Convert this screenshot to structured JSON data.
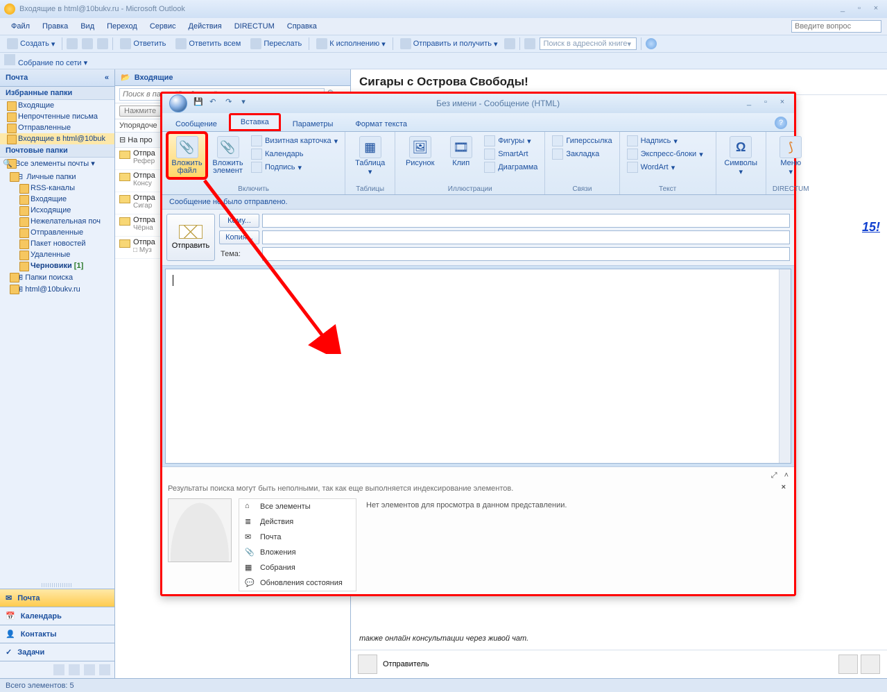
{
  "window_title": "Входящие в html@10bukv.ru - Microsoft Outlook",
  "menu": [
    "Файл",
    "Правка",
    "Вид",
    "Переход",
    "Сервис",
    "Действия",
    "DIRECTUM",
    "Справка"
  ],
  "question_placeholder": "Введите вопрос",
  "toolbar": {
    "create": "Создать",
    "reply": "Ответить",
    "reply_all": "Ответить всем",
    "forward": "Переслать",
    "follow_up": "К исполнению",
    "send_receive": "Отправить и получить",
    "addressbook_ph": "Поиск в адресной книге"
  },
  "toolbar2": {
    "meeting": "Собрание по сети"
  },
  "nav": {
    "header": "Почта",
    "fav_hdr": "Избранные папки",
    "fav": [
      "Входящие",
      "Непрочтенные письма",
      "Отправленные",
      "Входящие в html@10buk"
    ],
    "mail_hdr": "Почтовые папки",
    "all_items": "Все элементы почты",
    "tree_root": "Личные папки",
    "tree": [
      "RSS-каналы",
      "Входящие",
      "Исходящие",
      "Нежелательная поч",
      "Отправленные",
      "Пакет новостей",
      "Удаленные"
    ],
    "drafts": "Черновики",
    "drafts_count": "[1]",
    "search_folders": "Папки поиска",
    "account": "html@10bukv.ru",
    "big": [
      "Почта",
      "Календарь",
      "Контакты",
      "Задачи"
    ]
  },
  "list": {
    "header": "Входящие",
    "search_ph": "Поиск в папке \"Входящие\"",
    "hint_btn": "Нажмите",
    "sort": "Упорядоче",
    "group1": "На про",
    "msgs": [
      {
        "l1": "Отпра",
        "l2": "Рефер"
      },
      {
        "l1": "Отпра",
        "l2": "Консу"
      },
      {
        "l1": "Отпра",
        "l2": "Сигар"
      },
      {
        "l1": "Отпра",
        "l2": "Чёрна"
      },
      {
        "l1": "Отпра",
        "l2": "□ Муз"
      }
    ]
  },
  "reading": {
    "subject": "Сигары с Острова Свободы!",
    "frag": "15!",
    "body_tail": "также онлайн консультации через живой чат.",
    "sender_label": "Отправитель"
  },
  "compose": {
    "title": "Без имени - Сообщение (HTML)",
    "tabs": [
      "Сообщение",
      "Вставка",
      "Параметры",
      "Формат текста"
    ],
    "active_tab": 1,
    "info": "Сообщение не было отправлено.",
    "send": "Отправить",
    "to_btn": "Кому...",
    "cc_btn": "Копия...",
    "subject_lbl": "Тема:",
    "ribbon": {
      "g_include": "Включить",
      "attach_file": "Вложить файл",
      "attach_item": "Вложить элемент",
      "bizcard": "Визитная карточка",
      "calendar": "Календарь",
      "signature": "Подпись",
      "g_tables": "Таблицы",
      "table": "Таблица",
      "g_illus": "Иллюстрации",
      "picture": "Рисунок",
      "clip": "Клип",
      "shapes": "Фигуры",
      "smartart": "SmartArt",
      "chart": "Диаграмма",
      "g_links": "Связи",
      "hyperlink": "Гиперссылка",
      "bookmark": "Закладка",
      "g_text": "Текст",
      "textbox": "Надпись",
      "quickparts": "Экспресс-блоки",
      "wordart": "WordArt",
      "symbols": "Символы",
      "directum": "DIRECTUM",
      "menu": "Меню"
    },
    "people": {
      "note": "Результаты поиска могут быть неполными, так как еще выполняется индексирование элементов.",
      "empty": "Нет элементов для просмотра в данном представлении.",
      "menu": [
        "Все элементы",
        "Действия",
        "Почта",
        "Вложения",
        "Собрания",
        "Обновления состояния"
      ]
    }
  },
  "status": "Всего элементов: 5"
}
